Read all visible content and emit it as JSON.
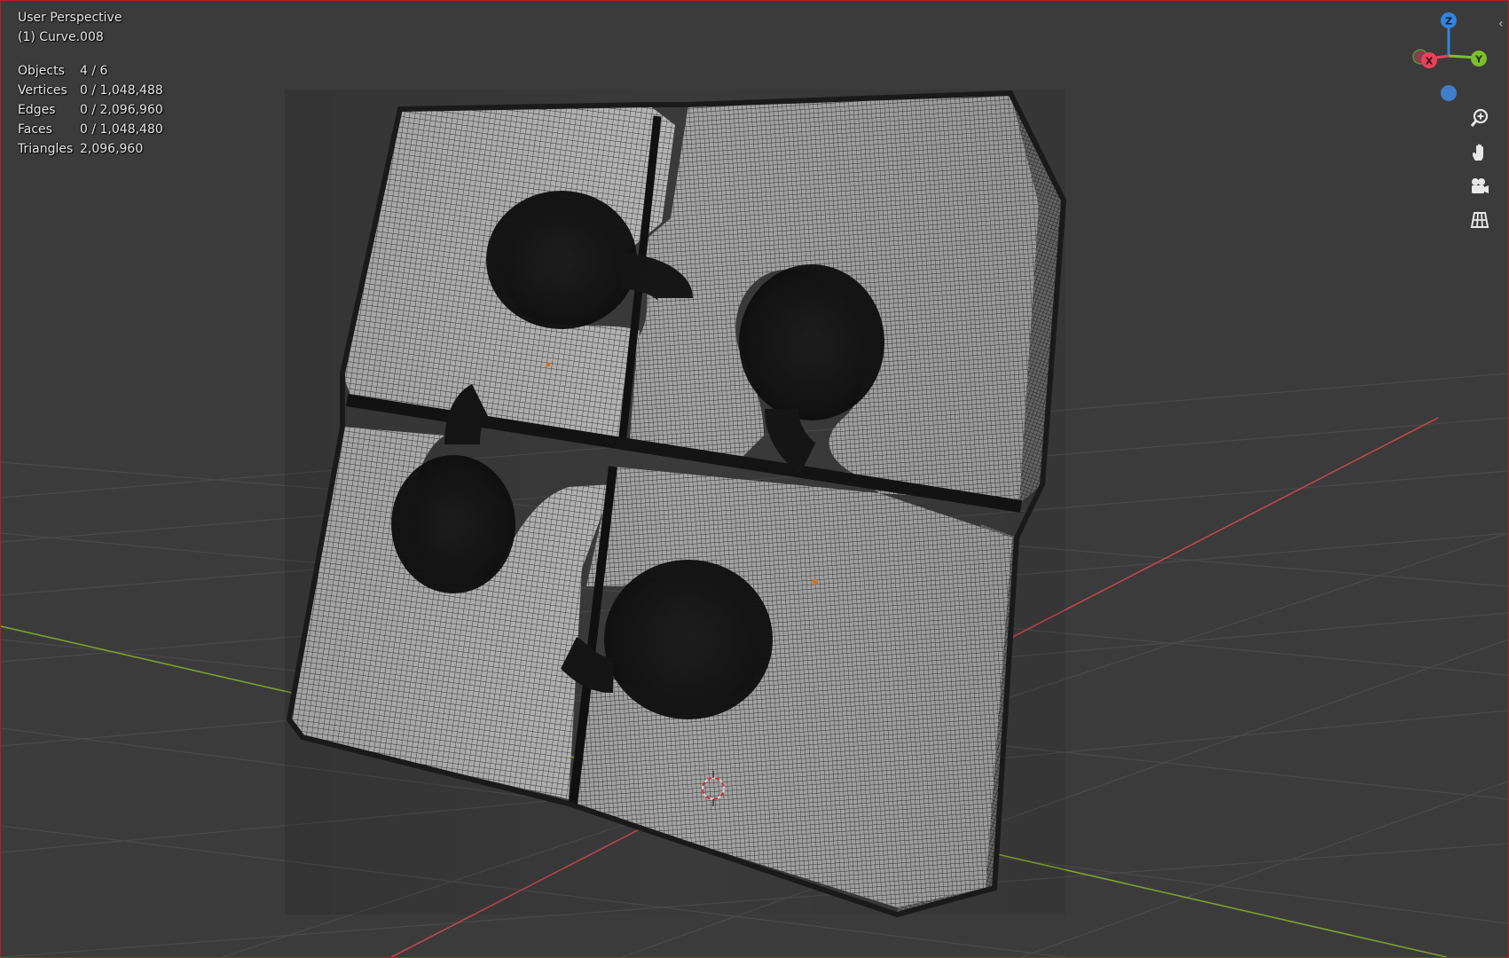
{
  "viewport": {
    "view_name": "User Perspective",
    "active_object": "(1) Curve.008"
  },
  "stats": [
    {
      "label": "Objects",
      "value": "4 / 6"
    },
    {
      "label": "Vertices",
      "value": "0 / 1,048,488"
    },
    {
      "label": "Edges",
      "value": "0 / 2,096,960"
    },
    {
      "label": "Faces",
      "value": "0 / 1,048,480"
    },
    {
      "label": "Triangles",
      "value": "2,096,960"
    }
  ],
  "gizmo": {
    "axis_z": "Z",
    "axis_y": "Y",
    "axis_x": "X",
    "colors": {
      "x": "#e8415a",
      "y": "#7bbf2a",
      "z": "#2f85e0",
      "neg_y": "#3f7ec9"
    }
  },
  "nav_buttons": [
    {
      "icon": "zoom-icon"
    },
    {
      "icon": "hand-pan-icon"
    },
    {
      "icon": "camera-icon"
    },
    {
      "icon": "ortho-grid-icon"
    }
  ],
  "colors": {
    "background": "#3b3b3b",
    "grid_line": "#4a4a4a",
    "x_axis_line": "#c0474b",
    "y_axis_line": "#7ea02d",
    "mesh_light": "#bdbdbd",
    "mesh_dark": "#1d1d1d",
    "selection_border": "#b32020"
  }
}
